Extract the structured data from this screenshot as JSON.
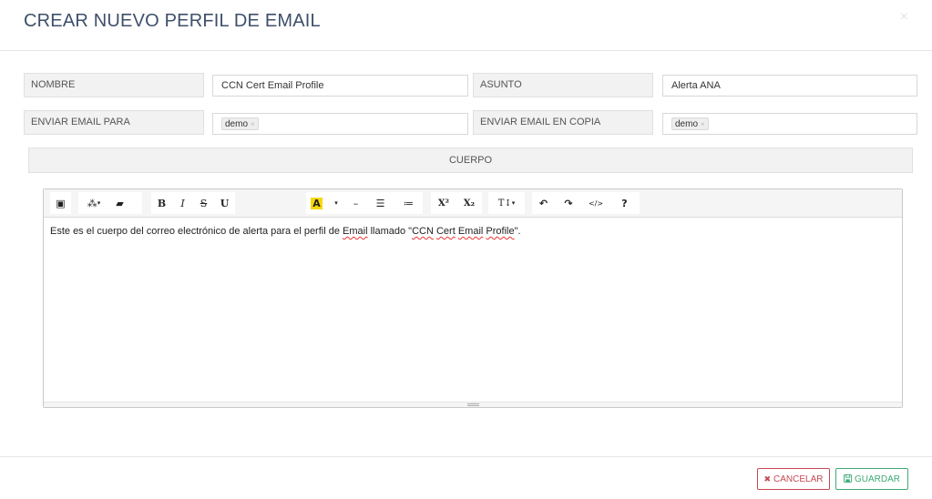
{
  "modal": {
    "title": "CREAR NUEVO PERFIL DE EMAIL",
    "close_glyph": "×"
  },
  "form": {
    "nombre_label": "NOMBRE",
    "nombre_value": "CCN Cert Email Profile",
    "asunto_label": "ASUNTO",
    "asunto_value": "Alerta ANA",
    "enviar_para_label": "ENVIAR EMAIL PARA",
    "enviar_para_tags": [
      "demo"
    ],
    "enviar_copia_label": "ENVIAR EMAIL EN COPIA",
    "enviar_copia_tags": [
      "demo"
    ],
    "cuerpo_label": "CUERPO"
  },
  "toolbar": {
    "picture": "▣",
    "magic": "⁂",
    "eraser": "▰",
    "bold": "B",
    "italic": "I",
    "strike": "S",
    "underline": "U",
    "color": "A",
    "color_caret": "▾",
    "hr": "–",
    "ul": "☰",
    "ol": "≔",
    "superscript": "X²",
    "subscript": "X₂",
    "fontsize": "T↕",
    "undo": "↶",
    "redo": "↷",
    "code": "</>",
    "help": "?"
  },
  "editor": {
    "text_a": "Este es el cuerpo del correo electrónico de alerta para el perfil de ",
    "text_b": "Email",
    "text_c": " llamado \"",
    "text_d": "CCN",
    "text_e": " ",
    "text_f": "Cert",
    "text_g": " ",
    "text_h": "Email",
    "text_i": " ",
    "text_j": "Profile",
    "text_k": "\"."
  },
  "footer": {
    "cancel_label": "CANCELAR",
    "save_label": "GUARDAR"
  },
  "colors": {
    "title": "#3e4f6a",
    "cancel": "#c64953",
    "save": "#3faa74",
    "color_highlight": "#f5d90a"
  }
}
